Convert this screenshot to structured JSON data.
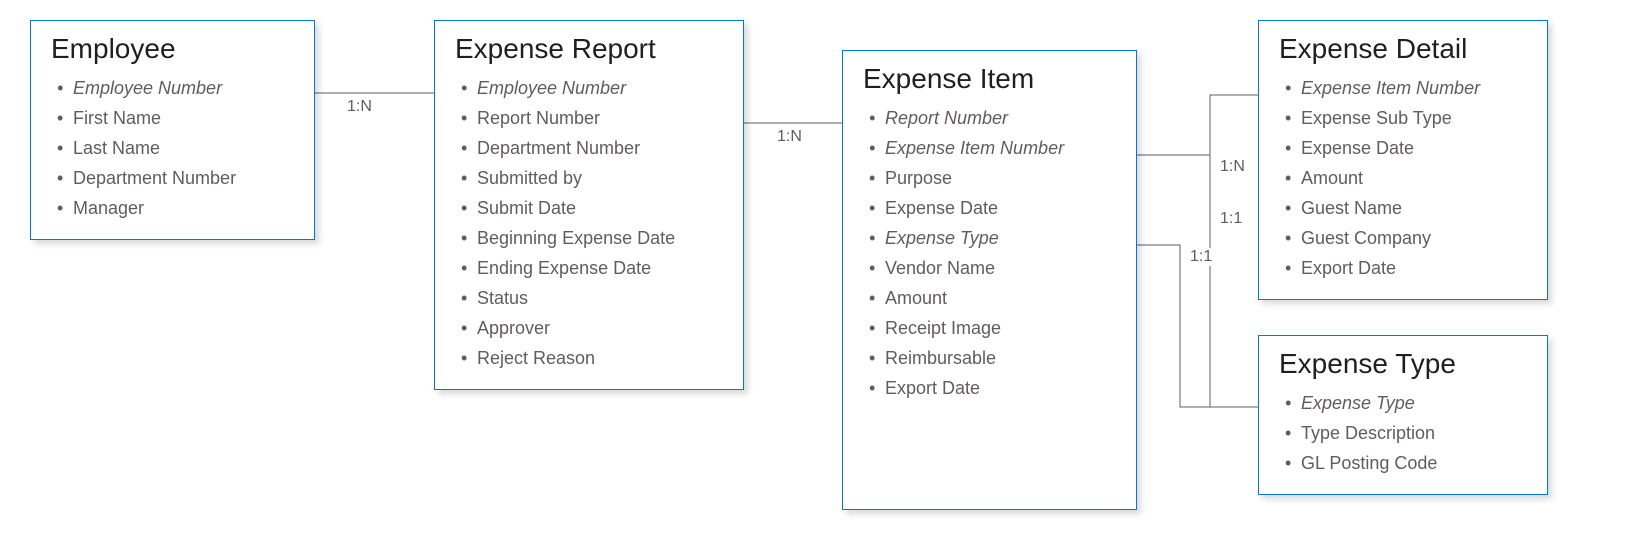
{
  "entities": {
    "employee": {
      "title": "Employee",
      "attrs": [
        {
          "label": "Employee Number",
          "key": true
        },
        {
          "label": "First Name"
        },
        {
          "label": "Last Name"
        },
        {
          "label": "Department Number"
        },
        {
          "label": "Manager"
        }
      ]
    },
    "expenseReport": {
      "title": "Expense Report",
      "attrs": [
        {
          "label": "Employee Number",
          "key": true
        },
        {
          "label": "Report Number"
        },
        {
          "label": "Department Number"
        },
        {
          "label": "Submitted by"
        },
        {
          "label": "Submit Date"
        },
        {
          "label": "Beginning Expense Date"
        },
        {
          "label": "Ending Expense Date"
        },
        {
          "label": "Status"
        },
        {
          "label": "Approver"
        },
        {
          "label": "Reject Reason"
        }
      ]
    },
    "expenseItem": {
      "title": "Expense Item",
      "attrs": [
        {
          "label": "Report Number",
          "key": true
        },
        {
          "label": "Expense Item Number",
          "key": true
        },
        {
          "label": "Purpose"
        },
        {
          "label": "Expense Date"
        },
        {
          "label": "Expense Type",
          "key": true
        },
        {
          "label": "Vendor Name"
        },
        {
          "label": "Amount"
        },
        {
          "label": "Receipt Image"
        },
        {
          "label": "Reimbursable"
        },
        {
          "label": "Export Date"
        }
      ]
    },
    "expenseDetail": {
      "title": "Expense Detail",
      "attrs": [
        {
          "label": "Expense Item Number",
          "key": true
        },
        {
          "label": "Expense Sub Type"
        },
        {
          "label": "Expense Date"
        },
        {
          "label": "Amount"
        },
        {
          "label": "Guest Name"
        },
        {
          "label": "Guest Company"
        },
        {
          "label": "Export Date"
        }
      ]
    },
    "expenseType": {
      "title": "Expense Type",
      "attrs": [
        {
          "label": "Expense Type",
          "key": true
        },
        {
          "label": "Type Description"
        },
        {
          "label": "GL Posting Code"
        }
      ]
    }
  },
  "relations": {
    "r1": "1:N",
    "r2": "1:N",
    "r3": "1:N",
    "r4": "1:1",
    "r5": "1:1"
  }
}
